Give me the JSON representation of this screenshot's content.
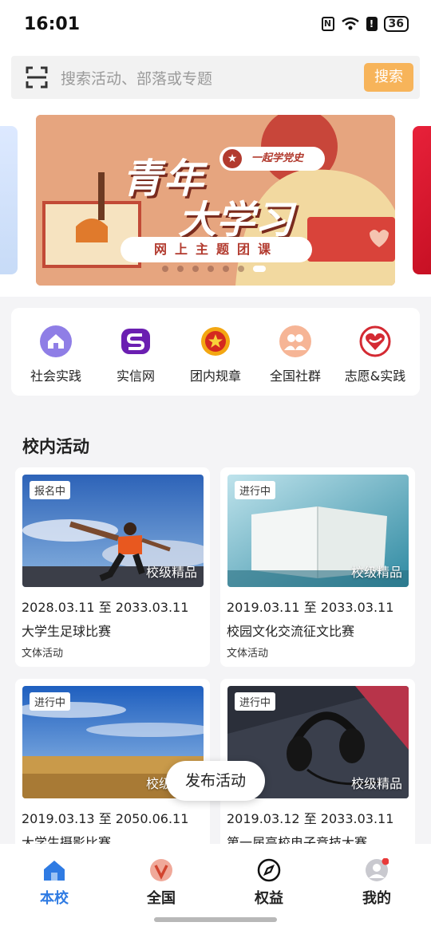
{
  "status_bar": {
    "time": "16:01",
    "battery": "36"
  },
  "search": {
    "placeholder": "搜索活动、部落或专题",
    "button_label": "搜索"
  },
  "banner": {
    "title_line1": "青年",
    "title_line2": "大学习",
    "badge": "一起学党史",
    "subtitle": "网上主题团课",
    "slide_count": 7,
    "active_slide": 7
  },
  "quick_nav": [
    {
      "label": "社会实践",
      "icon": "house-icon"
    },
    {
      "label": "实信网",
      "icon": "s-logo-icon"
    },
    {
      "label": "团内规章",
      "icon": "league-emblem-icon"
    },
    {
      "label": "全国社群",
      "icon": "people-icon"
    },
    {
      "label": "志愿&实践",
      "icon": "heart-icon"
    }
  ],
  "section": {
    "title": "校内活动"
  },
  "activities": [
    {
      "tag": "报名中",
      "quality": "校级精品",
      "date": "2028.03.11 至 2033.03.11",
      "name": "大学生足球比赛",
      "category": "文体活动"
    },
    {
      "tag": "进行中",
      "quality": "校级精品",
      "date": "2019.03.11 至 2033.03.11",
      "name": "校园文化交流征文比赛",
      "category": "文体活动"
    },
    {
      "tag": "进行中",
      "quality": "校级精品",
      "date": "2019.03.13 至 2050.06.11",
      "name": "大学生摄影比赛",
      "category": ""
    },
    {
      "tag": "进行中",
      "quality": "校级精品",
      "date": "2019.03.12 至 2033.03.11",
      "name": "第一届高校电子竞技大赛",
      "category": ""
    }
  ],
  "publish_button": "发布活动",
  "tabs": [
    {
      "label": "本校",
      "icon": "home-icon",
      "active": true
    },
    {
      "label": "全国",
      "icon": "v-logo-icon",
      "active": false
    },
    {
      "label": "权益",
      "icon": "compass-icon",
      "active": false
    },
    {
      "label": "我的",
      "icon": "profile-icon",
      "active": false
    }
  ],
  "colors": {
    "accent": "#2f7be3",
    "search_button": "#f7b45a",
    "notification_dot": "#e83a3a"
  }
}
